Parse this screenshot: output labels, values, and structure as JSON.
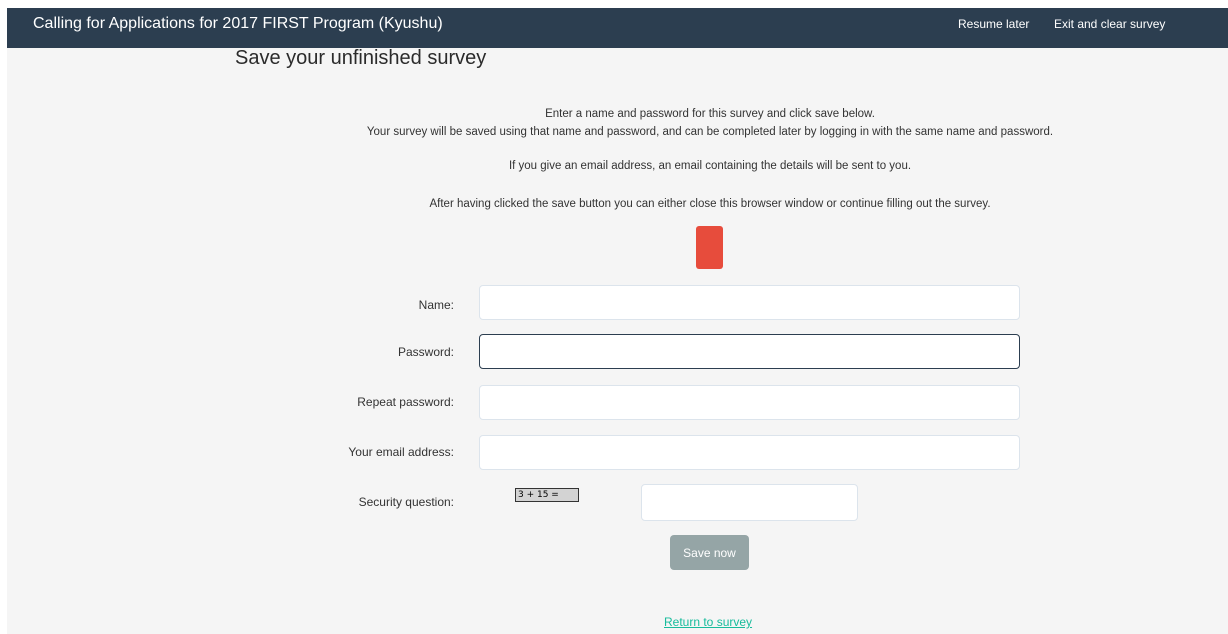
{
  "header": {
    "title": "Calling for Applications for 2017 FIRST Program (Kyushu)",
    "nav": {
      "resume_later": "Resume later",
      "exit_clear": "Exit and clear survey"
    }
  },
  "main": {
    "title": "Save your unfinished survey",
    "info": [
      "Enter a name and password for this survey and click save below.",
      "Your survey will be saved using that name and password, and can be completed later by logging in with the same name and password.",
      "If you give an email address, an email containing the details will be sent to you.",
      "After having clicked the save button you can either close this browser window or continue filling out the survey."
    ],
    "form": {
      "name_label": "Name:",
      "password_label": "Password:",
      "repeat_password_label": "Repeat password:",
      "email_label": "Your email address:",
      "security_label": "Security question:",
      "captcha_text": "3 + 15 =",
      "name_value": "",
      "password_value": "",
      "repeat_password_value": "",
      "email_value": "",
      "captcha_value": ""
    },
    "save_button": "Save now",
    "return_link": "Return to survey"
  },
  "colors": {
    "navbar": "#2c3e50",
    "background": "#f5f5f5",
    "error": "#e74c3c",
    "button": "#95a5a6",
    "link": "#18bc9c"
  }
}
